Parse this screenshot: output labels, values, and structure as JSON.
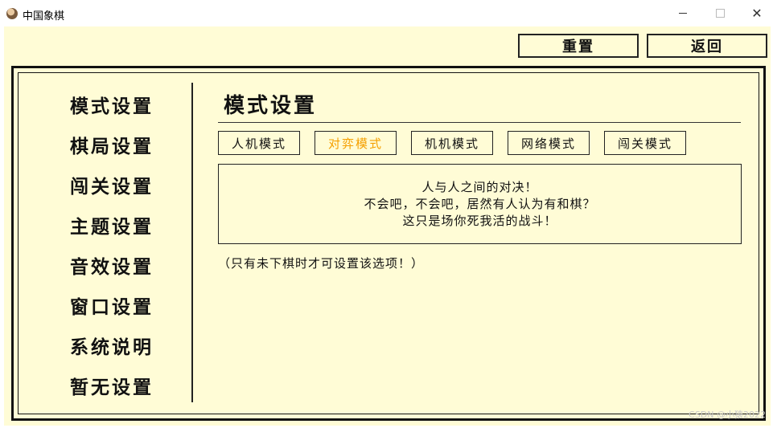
{
  "window": {
    "title": "中国象棋",
    "controls": {
      "minimize": "—",
      "maximize": "□",
      "close": "✕"
    }
  },
  "toolbar": {
    "reset_label": "重置",
    "back_label": "返回"
  },
  "sidebar": {
    "items": [
      {
        "label": "模式设置"
      },
      {
        "label": "棋局设置"
      },
      {
        "label": "闯关设置"
      },
      {
        "label": "主题设置"
      },
      {
        "label": "音效设置"
      },
      {
        "label": "窗口设置"
      },
      {
        "label": "系统说明"
      },
      {
        "label": "暂无设置"
      }
    ]
  },
  "main": {
    "heading": "模式设置",
    "modes": [
      {
        "label": "人机模式",
        "active": false
      },
      {
        "label": "对弈模式",
        "active": true
      },
      {
        "label": "机机模式",
        "active": false
      },
      {
        "label": "网络模式",
        "active": false
      },
      {
        "label": "闯关模式",
        "active": false
      }
    ],
    "description": [
      "人与人之间的对决！",
      "不会吧，不会吧，居然有人认为有和棋？",
      "这只是场你死我活的战斗！"
    ],
    "note": "（只有未下棋时才可设置该选项！）"
  },
  "watermark": "CSDN @小猿2022",
  "colors": {
    "background": "#fffcd6",
    "active_mode": "#f5a000",
    "border": "#222222"
  }
}
